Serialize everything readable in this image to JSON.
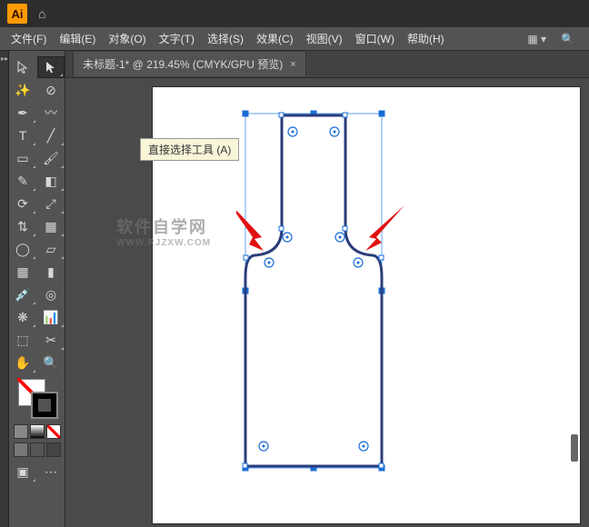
{
  "app": {
    "logo_text": "Ai"
  },
  "menu": {
    "file": "文件(F)",
    "edit": "编辑(E)",
    "object": "对象(O)",
    "type": "文字(T)",
    "select": "选择(S)",
    "effect": "效果(C)",
    "view": "视图(V)",
    "window": "窗口(W)",
    "help": "帮助(H)"
  },
  "tab": {
    "title": "未标题-1* @ 219.45% (CMYK/GPU 预览)",
    "close": "×"
  },
  "tooltip": {
    "direct_selection": "直接选择工具 (A)"
  },
  "watermark": {
    "line1": "软件自学网",
    "line2": "WWW.RJZXW.COM"
  },
  "tools": {
    "selection": "selection-tool",
    "direct_selection": "direct-selection-tool",
    "magic_wand": "magic-wand-tool",
    "lasso": "lasso-tool",
    "pen": "pen-tool",
    "curvature": "curvature-tool",
    "type": "type-tool",
    "line": "line-segment-tool",
    "rectangle": "rectangle-tool",
    "paintbrush": "paintbrush-tool",
    "shaper": "shaper-tool",
    "eraser": "eraser-tool",
    "rotate": "rotate-tool",
    "scale": "scale-tool",
    "width": "width-tool",
    "free_transform": "free-transform-tool",
    "shape_builder": "shape-builder-tool",
    "perspective": "perspective-grid-tool",
    "mesh": "mesh-tool",
    "gradient": "gradient-tool",
    "eyedropper": "eyedropper-tool",
    "blend": "blend-tool",
    "symbol_sprayer": "symbol-sprayer-tool",
    "column_graph": "column-graph-tool",
    "artboard": "artboard-tool",
    "slice": "slice-tool",
    "hand": "hand-tool",
    "zoom": "zoom-tool"
  },
  "colors": {
    "fill": "none",
    "stroke": "#000000",
    "accent": "#1a6dd6",
    "outline": "#2a3d7a"
  }
}
